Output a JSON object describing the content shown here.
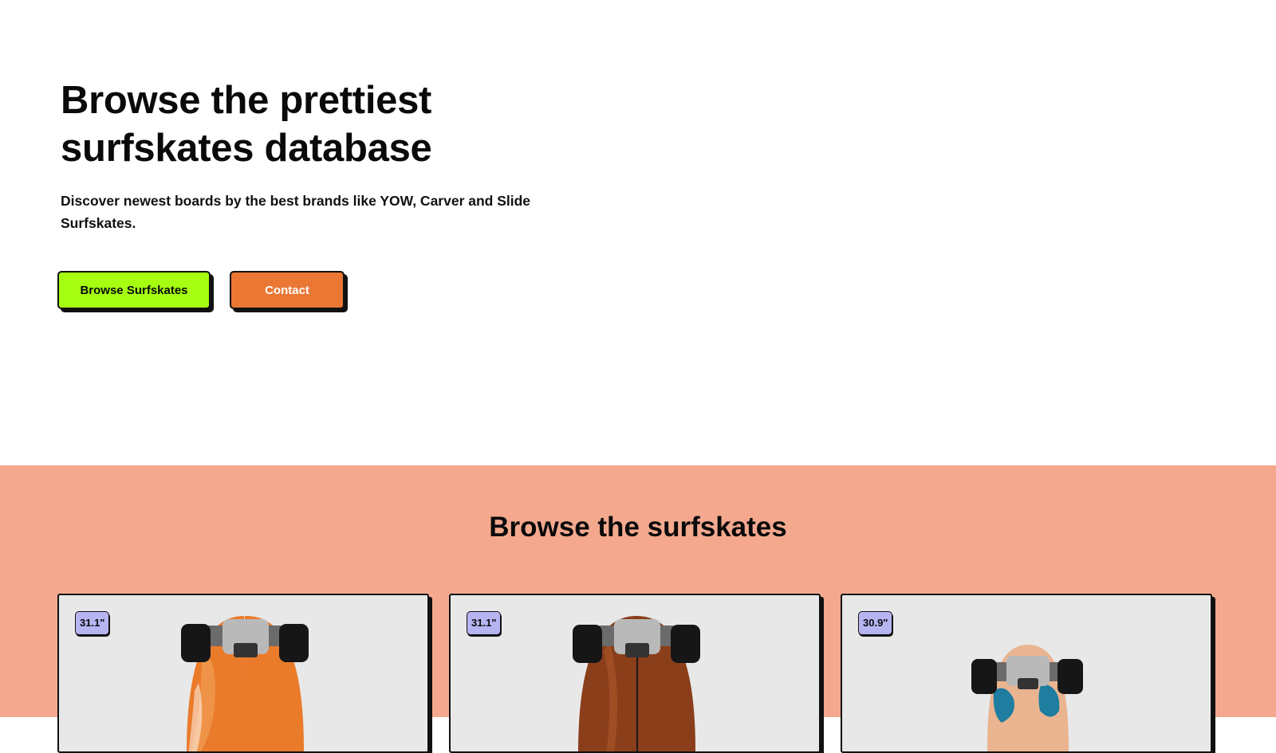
{
  "hero": {
    "title_line1": "Browse the prettiest",
    "title_line2": "surfskates database",
    "subtitle": "Discover newest boards by the best brands like YOW, Carver and Slide Surfskates.",
    "primary_button": "Browse Surfskates",
    "secondary_button": "Contact"
  },
  "browse": {
    "title": "Browse the surfskates",
    "cards": [
      {
        "size": "31.1\"",
        "deck_color": "#ea7b2b"
      },
      {
        "size": "31.1\"",
        "deck_color": "#8a3e1a"
      },
      {
        "size": "30.9\"",
        "deck_color": "#e9b48f"
      }
    ]
  },
  "colors": {
    "accent_green": "#a6ff10",
    "accent_orange": "#ea7733",
    "section_bg": "#f4a98f",
    "badge_bg": "#b7b4f2"
  }
}
